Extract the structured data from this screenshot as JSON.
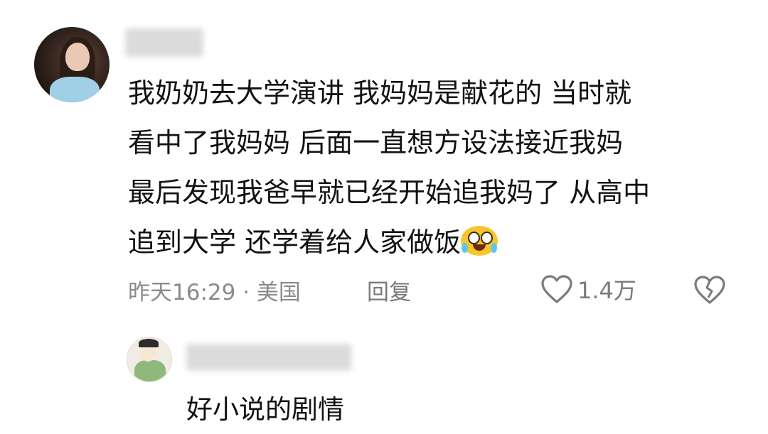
{
  "comment": {
    "lines": [
      "我奶奶去大学演讲 我妈妈是献花的 当时就",
      "看中了我妈妈 后面一直想方设法接近我妈",
      "最后发现我爸早就已经开始追我妈了 从高中",
      "追到大学 还学着给人家做饭"
    ],
    "emoji": "loudly-crying-emoji",
    "time": "昨天16:29 · 美国",
    "reply_label": "回复",
    "like_count": "1.4万"
  },
  "reply": {
    "text": "好小说的剧情"
  },
  "colors": {
    "meta_gray": "#8a8a8a",
    "emoji_yellow": "#f7c62f",
    "tear_blue": "#5fc6f2"
  },
  "icons": {
    "like": "heart-outline-icon",
    "dislike": "broken-heart-icon"
  }
}
